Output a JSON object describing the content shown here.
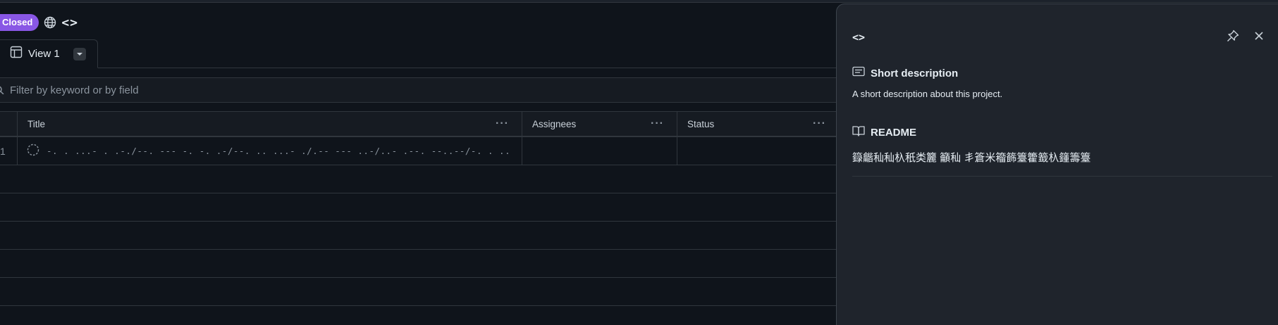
{
  "header": {
    "status_badge": "Closed",
    "icon": "globe-icon",
    "project_title": "<>"
  },
  "tabs": [
    {
      "label": "View 1",
      "icon": "table-icon"
    }
  ],
  "filter": {
    "placeholder": "Filter by keyword or by field"
  },
  "table": {
    "columns": [
      "Title",
      "Assignees",
      "Status"
    ],
    "rows": [
      {
        "number": "1",
        "title": "-. . ...- . .-./--. --- -. -. .-/--. .. ...- ./.-- --- ..-/..- .--. --..--/-. . ...- . .-./--. --- -. -. .-/.-.. . -/.-- --- ..-/-.. --...",
        "assignees": "",
        "status": ""
      }
    ]
  },
  "panel": {
    "title": "<>",
    "short_description_heading": "Short description",
    "short_description": "A short description about this project.",
    "readme_heading": "README",
    "readme_text": "籙龤秈秈杁秖类籭 籲秈 丯篬米籕籂籉籗籖杁籦籌籉"
  },
  "colors": {
    "badge": "#8957e5",
    "background": "#0f141b",
    "panel": "#1f242c",
    "border": "#30363d"
  }
}
